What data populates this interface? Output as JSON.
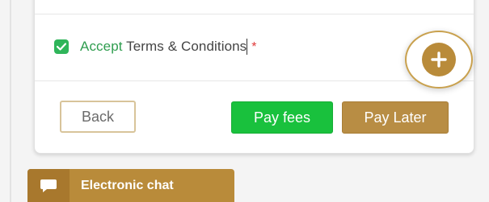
{
  "terms": {
    "accept_word": "Accept",
    "label_rest": " Terms & Conditions",
    "required_mark": "*",
    "checked": true
  },
  "actions": {
    "back_label": "Back",
    "pay_label": "Pay fees",
    "later_label": "Pay Later"
  },
  "fab": {
    "icon": "plus-icon"
  },
  "chat": {
    "label": "Electronic chat",
    "icon": "chat-bubble-icon"
  },
  "colors": {
    "accent_gold": "#b98b3a",
    "pay_green": "#19c13d",
    "check_green": "#2fb55a",
    "required_red": "#e03a3a"
  }
}
